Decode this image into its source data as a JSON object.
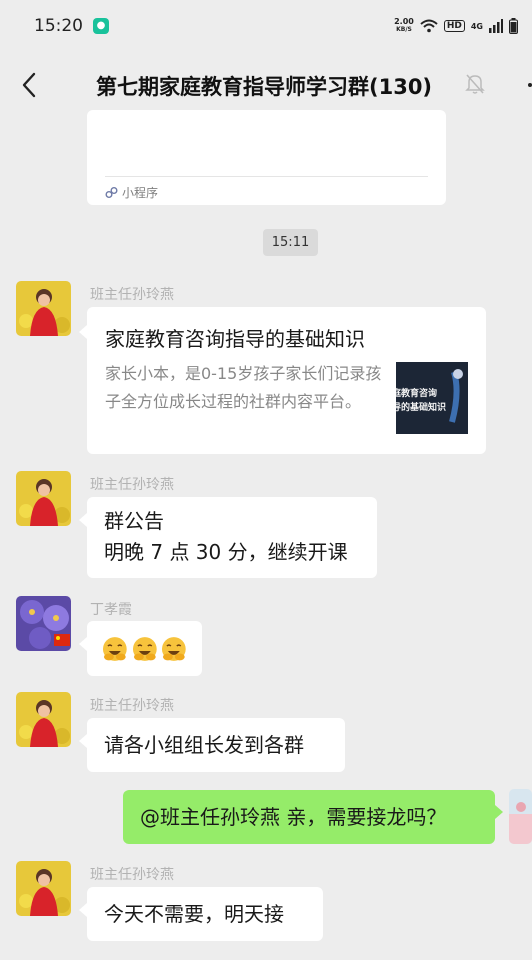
{
  "status": {
    "time": "15:20",
    "net_speed_value": "2.00",
    "net_speed_unit": "KB/S",
    "hd": "HD",
    "signal": "4G"
  },
  "header": {
    "title": "第七期家庭教育指导师学习群(130)"
  },
  "prev_card": {
    "label": "小程序"
  },
  "timestamp": "15:11",
  "messages": [
    {
      "sender": "班主任孙玲燕",
      "link": {
        "title": "家庭教育咨询指导的基础知识",
        "description": "家长小本，是0-15岁孩子家长们记录孩子全方位成长过程的社群内容平台。",
        "thumb_line1": "庭教育咨询",
        "thumb_line2": "导的基础知识"
      }
    },
    {
      "sender": "班主任孙玲燕",
      "line1": "群公告",
      "line2": "明晚 7 点 30 分，继续开课"
    },
    {
      "sender": "丁孝霞",
      "emoji_count": 3
    },
    {
      "sender": "班主任孙玲燕",
      "text": "请各小组组长发到各群"
    },
    {
      "self": true,
      "text": "@班主任孙玲燕  亲，需要接龙吗？"
    },
    {
      "sender": "班主任孙玲燕",
      "text": "今天不需要，明天接"
    }
  ],
  "colors": {
    "background": "#ededed",
    "self_bubble": "#95ec69",
    "other_bubble": "#ffffff",
    "sender_name": "#b2b2b2"
  }
}
